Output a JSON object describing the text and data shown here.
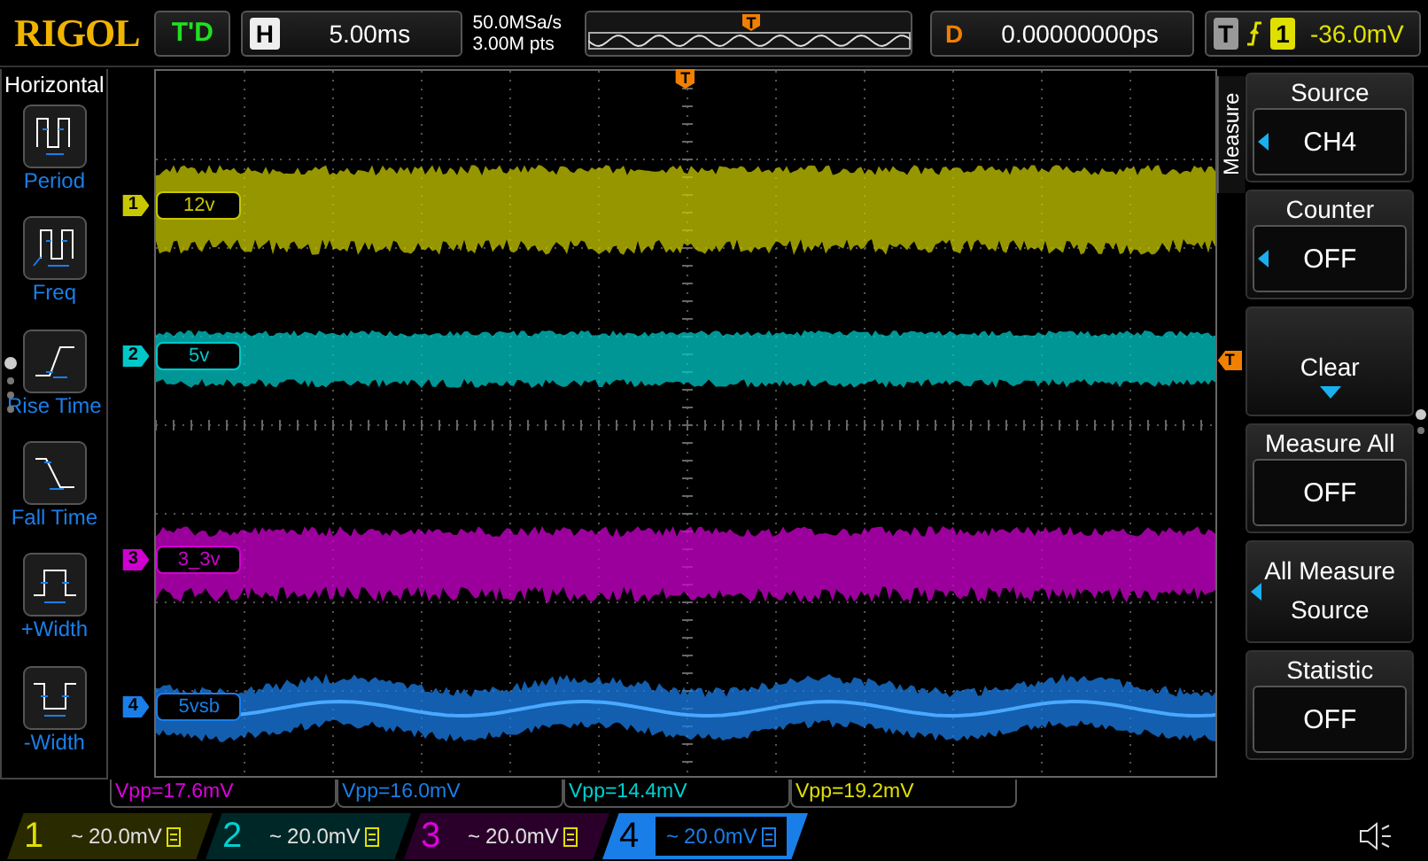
{
  "header": {
    "logo": "RIGOL",
    "trigger_status": "T'D",
    "timebase_label": "H",
    "timebase": "5.00ms",
    "sample_rate": "50.0MSa/s",
    "memory_depth": "3.00M pts",
    "position_marker": "T",
    "delay_label": "D",
    "delay": "0.00000000ps",
    "trigger_label": "T",
    "trigger_source": "1",
    "trigger_level": "-36.0mV"
  },
  "left_menu": {
    "title": "Horizontal",
    "items": [
      {
        "kind": "period",
        "label": "Period"
      },
      {
        "kind": "freq",
        "label": "Freq"
      },
      {
        "kind": "rise",
        "label": "Rise Time"
      },
      {
        "kind": "fall",
        "label": "Fall Time"
      },
      {
        "kind": "pwidth",
        "label": "+Width"
      },
      {
        "kind": "nwidth",
        "label": "-Width"
      }
    ]
  },
  "channels": [
    {
      "marker": "1",
      "label": "12v",
      "color": "#c8c800"
    },
    {
      "marker": "2",
      "label": "5v",
      "color": "#00c8c8"
    },
    {
      "marker": "3",
      "label": "3_3v",
      "color": "#d000d0"
    },
    {
      "marker": "4",
      "label": "5vsb",
      "color": "#1a7ee8"
    }
  ],
  "trigger_marker": "T",
  "trigger_level_marker": "T",
  "right_menu": {
    "tab": "Measure",
    "items": [
      {
        "kind": "select",
        "title": "Source",
        "value": "CH4",
        "arrow": true
      },
      {
        "kind": "select",
        "title": "Counter",
        "value": "OFF",
        "arrow": true
      },
      {
        "kind": "action",
        "label": "Clear"
      },
      {
        "kind": "select",
        "title": "Measure All",
        "value": "OFF",
        "arrow": false
      },
      {
        "kind": "submenu",
        "label": "All Measure Source",
        "arrow": true
      },
      {
        "kind": "select",
        "title": "Statistic",
        "value": "OFF",
        "arrow": false
      }
    ]
  },
  "measurements": [
    {
      "text": "Vpp=17.6mV",
      "color": "#e000e0"
    },
    {
      "text": "Vpp=16.0mV",
      "color": "#1a7ee8"
    },
    {
      "text": "Vpp=14.4mV",
      "color": "#00d0d0"
    },
    {
      "text": "Vpp=19.2mV",
      "color": "#e0e000"
    }
  ],
  "channel_bar": [
    {
      "number": "1",
      "coupling": "~",
      "scale": "20.0mV",
      "color": "#e0e000",
      "selected": false
    },
    {
      "number": "2",
      "coupling": "~",
      "scale": "20.0mV",
      "color": "#00d0d0",
      "selected": false
    },
    {
      "number": "3",
      "coupling": "~",
      "scale": "20.0mV",
      "color": "#e000e0",
      "selected": false
    },
    {
      "number": "4",
      "coupling": "~",
      "scale": "20.0mV",
      "color": "#1a7ee8",
      "selected": true
    }
  ]
}
